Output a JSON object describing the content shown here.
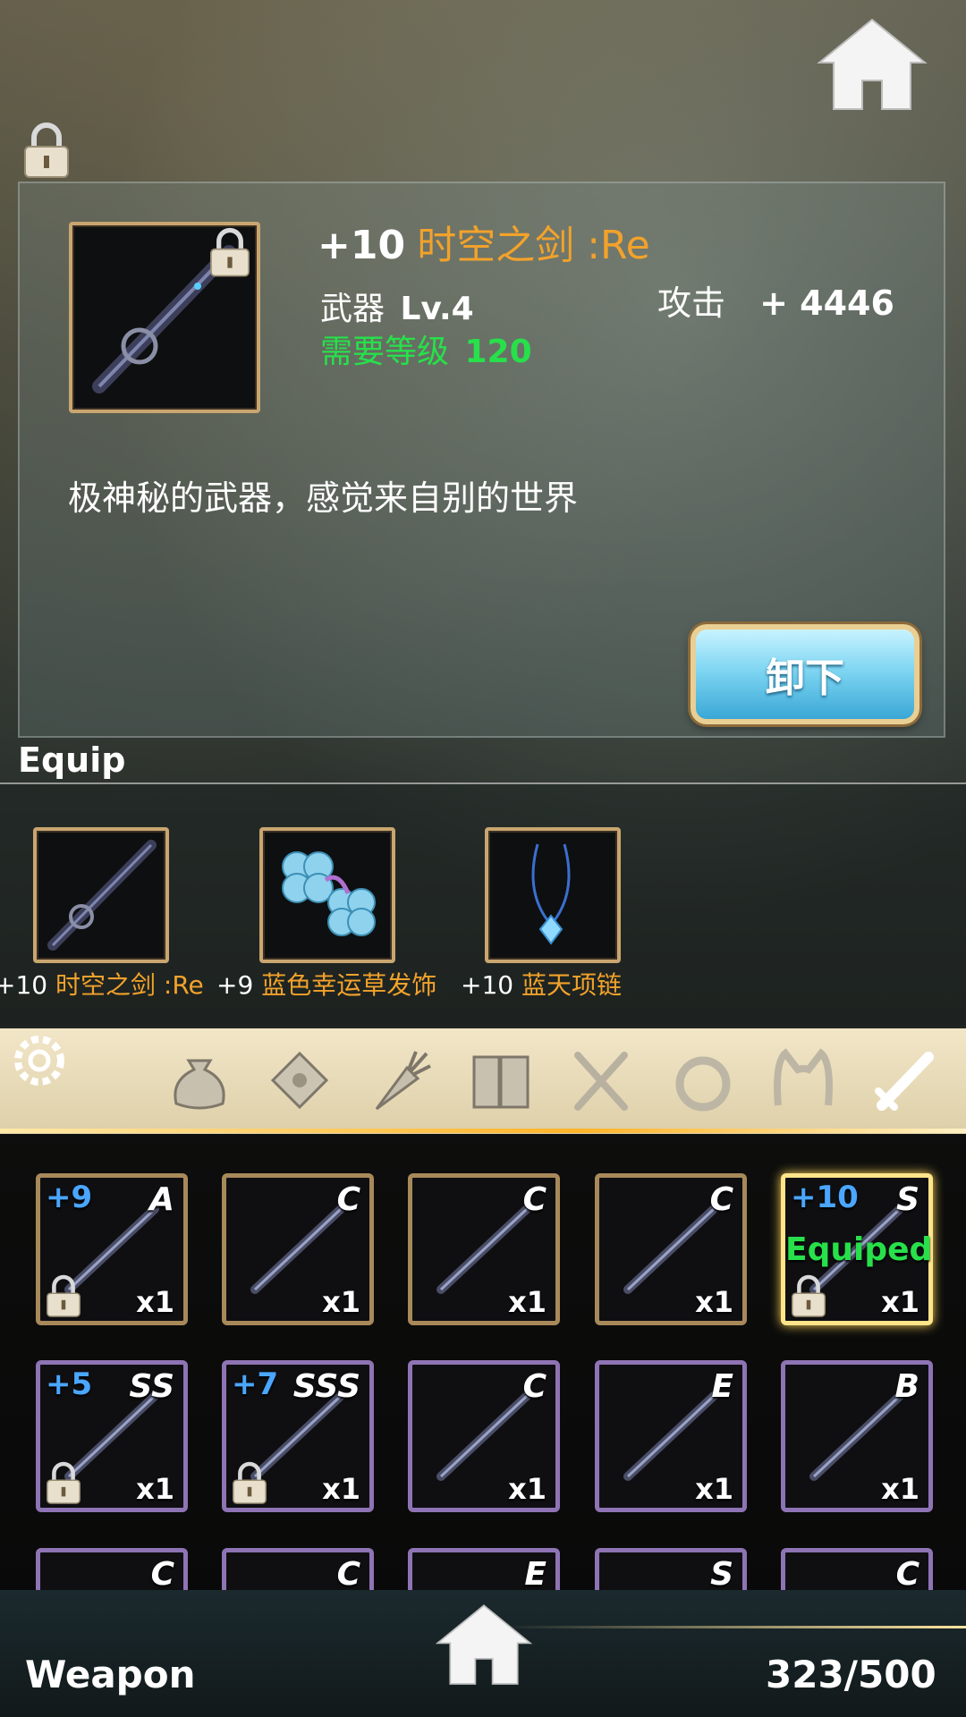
{
  "detail": {
    "enhance": "+10",
    "name": "时空之剑 :Re",
    "type_label": "武器",
    "level": "Lv.4",
    "req_label": "需要等级",
    "req_value": "120",
    "stat_label": "攻击",
    "stat_value": "+ 4446",
    "description": "极神秘的武器，感觉来自别的世界",
    "unequip_label": "卸下"
  },
  "equip": {
    "title": "Equip",
    "items": [
      {
        "plus": "+10",
        "name": "时空之剑 :Re",
        "icon": "sword-icon"
      },
      {
        "plus": "+9",
        "name": "蓝色幸运草发饰",
        "icon": "clover-hairpin-icon"
      },
      {
        "plus": "+10",
        "name": "蓝天项链",
        "icon": "necklace-icon"
      }
    ]
  },
  "tabs": [
    {
      "icon": "settings-icon"
    },
    {
      "icon": "bag-icon"
    },
    {
      "icon": "letter-icon"
    },
    {
      "icon": "carrot-icon"
    },
    {
      "icon": "book-icon"
    },
    {
      "icon": "utensils-icon"
    },
    {
      "icon": "ring-icon"
    },
    {
      "icon": "cat-ears-icon"
    },
    {
      "icon": "sword-tab-icon"
    }
  ],
  "grid": [
    {
      "plus": "+9",
      "grade": "A",
      "qty": "x1",
      "locked": true,
      "equiped": "",
      "frame": "gold",
      "icon": "staff-icon"
    },
    {
      "plus": "",
      "grade": "C",
      "qty": "x1",
      "locked": false,
      "equiped": "",
      "frame": "gold",
      "icon": "sword-icon"
    },
    {
      "plus": "",
      "grade": "C",
      "qty": "x1",
      "locked": false,
      "equiped": "",
      "frame": "gold",
      "icon": "scythe-icon"
    },
    {
      "plus": "",
      "grade": "C",
      "qty": "x1",
      "locked": false,
      "equiped": "",
      "frame": "gold",
      "icon": "spear-icon"
    },
    {
      "plus": "+10",
      "grade": "S",
      "qty": "x1",
      "locked": true,
      "equiped": "Equiped",
      "frame": "sel",
      "icon": "sword-icon"
    },
    {
      "plus": "+5",
      "grade": "SS",
      "qty": "x1",
      "locked": true,
      "equiped": "",
      "frame": "purple",
      "icon": "axe-icon"
    },
    {
      "plus": "+7",
      "grade": "SSS",
      "qty": "x1",
      "locked": true,
      "equiped": "",
      "frame": "purple",
      "icon": "blade-icon"
    },
    {
      "plus": "",
      "grade": "C",
      "qty": "x1",
      "locked": false,
      "equiped": "",
      "frame": "purple",
      "icon": "dagger-icon"
    },
    {
      "plus": "",
      "grade": "E",
      "qty": "x1",
      "locked": false,
      "equiped": "",
      "frame": "purple",
      "icon": "blade-icon"
    },
    {
      "plus": "",
      "grade": "B",
      "qty": "x1",
      "locked": false,
      "equiped": "",
      "frame": "purple",
      "icon": "crossbow-icon"
    },
    {
      "plus": "",
      "grade": "C",
      "qty": "",
      "locked": false,
      "equiped": "",
      "frame": "purple",
      "icon": ""
    },
    {
      "plus": "",
      "grade": "C",
      "qty": "",
      "locked": false,
      "equiped": "",
      "frame": "purple",
      "icon": ""
    },
    {
      "plus": "",
      "grade": "E",
      "qty": "",
      "locked": false,
      "equiped": "",
      "frame": "purple",
      "icon": ""
    },
    {
      "plus": "",
      "grade": "S",
      "qty": "",
      "locked": false,
      "equiped": "",
      "frame": "purple",
      "icon": ""
    },
    {
      "plus": "",
      "grade": "C",
      "qty": "",
      "locked": false,
      "equiped": "",
      "frame": "purple",
      "icon": ""
    }
  ],
  "footer": {
    "category": "Weapon",
    "capacity": "323/500"
  },
  "colors": {
    "accent_orange": "#f2a22b",
    "required_green": "#27e04a",
    "enhance_blue": "#4aa6ff"
  }
}
